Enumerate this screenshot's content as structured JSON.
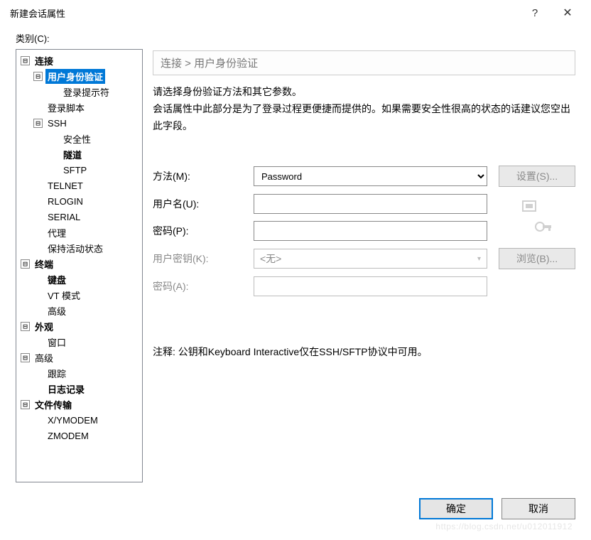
{
  "titlebar": {
    "title": "新建会话属性",
    "help": "?",
    "close": "✕"
  },
  "category_label": "类别(C):",
  "tree": {
    "connection": "连接",
    "auth": "用户身份验证",
    "login_prompt": "登录提示符",
    "login_script": "登录脚本",
    "ssh": "SSH",
    "security": "安全性",
    "tunnel": "隧道",
    "sftp": "SFTP",
    "telnet": "TELNET",
    "rlogin": "RLOGIN",
    "serial": "SERIAL",
    "proxy": "代理",
    "keepalive": "保持活动状态",
    "terminal": "终端",
    "keyboard": "键盘",
    "vt_mode": "VT 模式",
    "advanced_term": "高级",
    "appearance": "外观",
    "window": "窗口",
    "advanced": "高级",
    "trace": "跟踪",
    "logging": "日志记录",
    "file_transfer": "文件传输",
    "xymodem": "X/YMODEM",
    "zmodem": "ZMODEM"
  },
  "breadcrumb": "连接 > 用户身份验证",
  "desc_line1": "请选择身份验证方法和其它参数。",
  "desc_line2": "会话属性中此部分是为了登录过程更便捷而提供的。如果需要安全性很高的状态的话建议您空出此字段。",
  "form": {
    "method_label": "方法(M):",
    "method_value": "Password",
    "settings_btn": "设置(S)...",
    "username_label": "用户名(U):",
    "username_value": "",
    "password_label": "密码(P):",
    "password_value": "",
    "userkey_label": "用户密钥(K):",
    "userkey_value": "<无>",
    "browse_btn": "浏览(B)...",
    "keypass_label": "密码(A):"
  },
  "note": "注释: 公钥和Keyboard Interactive仅在SSH/SFTP协议中可用。",
  "buttons": {
    "ok": "确定",
    "cancel": "取消"
  },
  "toggle_minus": "⊟",
  "watermark": "https://blog.csdn.net/u012011912"
}
